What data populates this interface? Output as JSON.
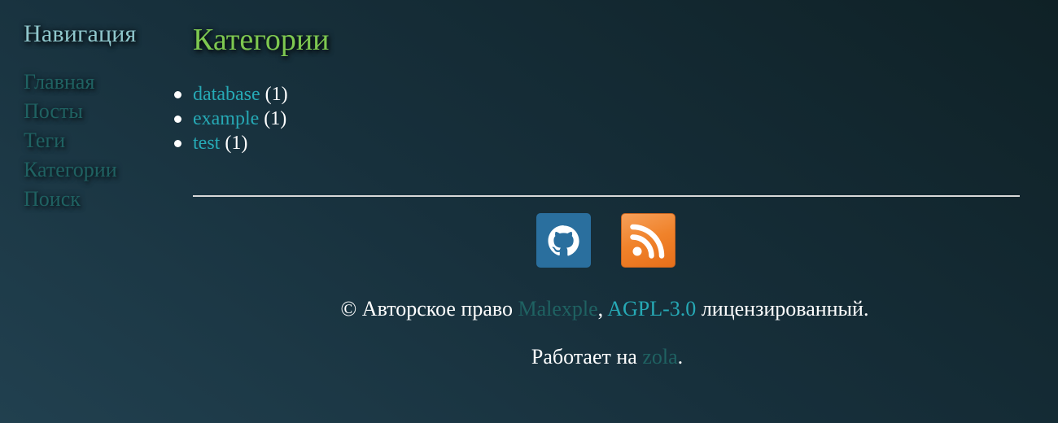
{
  "sidebar": {
    "title": "Навигация",
    "items": [
      {
        "label": "Главная"
      },
      {
        "label": "Посты"
      },
      {
        "label": "Теги"
      },
      {
        "label": "Категории"
      },
      {
        "label": "Поиск"
      }
    ]
  },
  "main": {
    "title": "Категории",
    "categories": [
      {
        "name": "database",
        "count": "(1)"
      },
      {
        "name": "example",
        "count": "(1)"
      },
      {
        "name": "test",
        "count": "(1)"
      }
    ]
  },
  "social": {
    "icons": [
      "github-icon",
      "rss-icon"
    ]
  },
  "footer": {
    "copyright_symbol": "©",
    "copyright_text": "Авторское право",
    "author": "Malexple",
    "separator": ",",
    "license": "AGPL-3.0",
    "licensed_text": "лицензированный",
    "period": ".",
    "powered_text": "Работает на",
    "engine": "zola",
    "powered_period": "."
  },
  "colors": {
    "heading_accent": "#7ec850",
    "nav_title": "#8fc7cc",
    "nav_link": "#1f6262",
    "link": "#26a9b5"
  }
}
